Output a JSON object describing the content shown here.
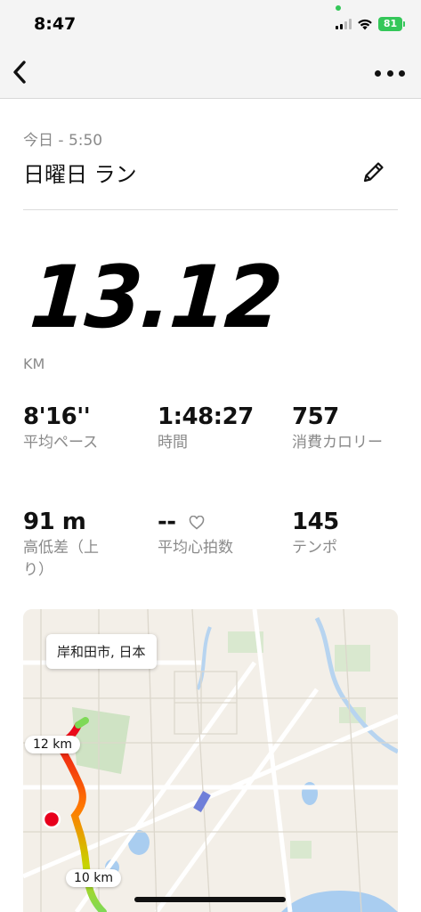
{
  "status_bar": {
    "time": "8:47",
    "battery": "81"
  },
  "header": {
    "date": "今日 - 5:50",
    "title": "日曜日 ラン"
  },
  "summary": {
    "distance": "13.12",
    "unit": "KM"
  },
  "stats": [
    {
      "value": "8'16''",
      "label": "平均ペース"
    },
    {
      "value": "1:48:27",
      "label": "時間"
    },
    {
      "value": "757",
      "label": "消費カロリー"
    },
    {
      "value": "91 m",
      "label": "高低差（上り）"
    },
    {
      "value": "--",
      "label": "平均心拍数"
    },
    {
      "value": "145",
      "label": "テンポ"
    }
  ],
  "map": {
    "location": "岸和田市, 日本",
    "markers": [
      "12 km",
      "10 km"
    ]
  },
  "icons": {
    "back": "chevron-left-icon",
    "more": "ellipsis-icon",
    "edit": "pencil-icon",
    "heart": "heart-outline-icon"
  },
  "colors": {
    "battery": "#34c759",
    "route_start": "#e8001c"
  }
}
